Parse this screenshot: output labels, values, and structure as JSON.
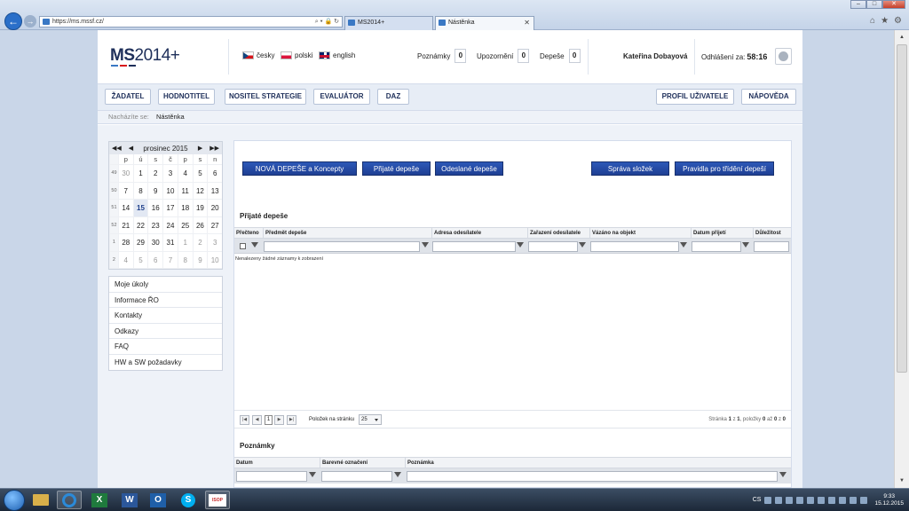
{
  "browser": {
    "url": "https://ms.mssf.cz/",
    "tabs": [
      {
        "label": "MS2014+"
      },
      {
        "label": "Nástěnka"
      }
    ],
    "win_min": "–",
    "win_max": "□",
    "win_close": "✕",
    "tab_close": "✕"
  },
  "header": {
    "logo_bold": "MS",
    "logo_light": "2014+",
    "logo_colors": [
      "#d7141a",
      "#1e2f5a",
      "#3a78c4"
    ],
    "languages": [
      {
        "label": "česky",
        "icon": "flag-cz-icon"
      },
      {
        "label": "polski",
        "icon": "flag-pl-icon"
      },
      {
        "label": "english",
        "icon": "flag-en-icon"
      }
    ],
    "counters": [
      {
        "label": "Poznámky",
        "value": "0"
      },
      {
        "label": "Upozornění",
        "value": "0"
      },
      {
        "label": "Depeše",
        "value": "0"
      }
    ],
    "user": "Kateřina Dobayová",
    "logout_label": "Odhlášení za:",
    "logout_time": "58:16"
  },
  "menu": {
    "left": [
      "ŽADATEL",
      "HODNOTITEL",
      "NOSITEL STRATEGIE",
      "EVALUÁTOR",
      "DAZ"
    ],
    "right": [
      "PROFIL UŽIVATELE",
      "NÁPOVĚDA"
    ]
  },
  "breadcrumb": {
    "label": "Nacházíte se:",
    "current": "Nástěnka"
  },
  "calendar": {
    "title": "prosinec 2015",
    "prev_year": "◀◀",
    "prev_month": "◀",
    "next_month": "▶",
    "next_year": "▶▶",
    "days_of_week": [
      "p",
      "ú",
      "s",
      "č",
      "p",
      "s",
      "n"
    ],
    "weeks": [
      {
        "wk": "49",
        "days": [
          "30",
          "1",
          "2",
          "3",
          "4",
          "5",
          "6"
        ]
      },
      {
        "wk": "50",
        "days": [
          "7",
          "8",
          "9",
          "10",
          "11",
          "12",
          "13"
        ]
      },
      {
        "wk": "51",
        "days": [
          "14",
          "15",
          "16",
          "17",
          "18",
          "19",
          "20"
        ]
      },
      {
        "wk": "52",
        "days": [
          "21",
          "22",
          "23",
          "24",
          "25",
          "26",
          "27"
        ]
      },
      {
        "wk": "1",
        "days": [
          "28",
          "29",
          "30",
          "31",
          "1",
          "2",
          "3"
        ]
      },
      {
        "wk": "2",
        "days": [
          "4",
          "5",
          "6",
          "7",
          "8",
          "9",
          "10"
        ]
      }
    ],
    "today": "15"
  },
  "sidebar_links": [
    "Moje úkoly",
    "Informace ŘO",
    "Kontakty",
    "Odkazy",
    "FAQ",
    "HW a SW požadavky"
  ],
  "actions": {
    "left": [
      "NOVÁ DEPEŠE a Koncepty",
      "Přijaté depeše",
      "Odeslané depeše"
    ],
    "right": [
      "Správa složek",
      "Pravidla pro třídění depeší"
    ]
  },
  "inbox": {
    "title": "Přijaté depeše",
    "columns": [
      "Přečteno",
      "Předmět depeše",
      "Adresa odesílatele",
      "Zařazení odesílatele",
      "Vázáno na objekt",
      "Datum přijetí",
      "Důležitost"
    ],
    "empty_text": "Nenalezeny žádné záznamy k zobrazení"
  },
  "pager": {
    "first": "|◀",
    "prev": "◀",
    "next": "▶",
    "last": "▶|",
    "current_page": "1",
    "items_label": "Položek na stránku",
    "page_size": "25",
    "info_prefix": "Stránka ",
    "info_page": "1",
    "info_mid": " z ",
    "info_total": "1",
    "info_items_prefix": ", položky ",
    "info_from": "0",
    "info_to_label": " až ",
    "info_to": "0",
    "info_of_label": " z ",
    "info_count": "0"
  },
  "notes": {
    "title": "Poznámky",
    "columns": [
      "Datum",
      "Barevné označení",
      "Poznámka"
    ]
  },
  "taskbar": {
    "apps": [
      {
        "name": "file-explorer-icon",
        "color": "#d9b04a"
      },
      {
        "name": "internet-explorer-icon",
        "color": "#2b8ad8"
      },
      {
        "name": "excel-icon",
        "color": "#1f7a3d"
      },
      {
        "name": "word-icon",
        "color": "#2b579a"
      },
      {
        "name": "outlook-icon",
        "color": "#1f5fa8"
      },
      {
        "name": "skype-icon",
        "color": "#00aff0"
      },
      {
        "name": "isop-icon",
        "color": "#c62828"
      }
    ],
    "excel_glyph": "X",
    "word_glyph": "W",
    "outlook_glyph": "O",
    "skype_glyph": "S",
    "isop_glyph": "ISOP",
    "language": "CS",
    "time": "9:33",
    "date": "15.12.2015"
  }
}
